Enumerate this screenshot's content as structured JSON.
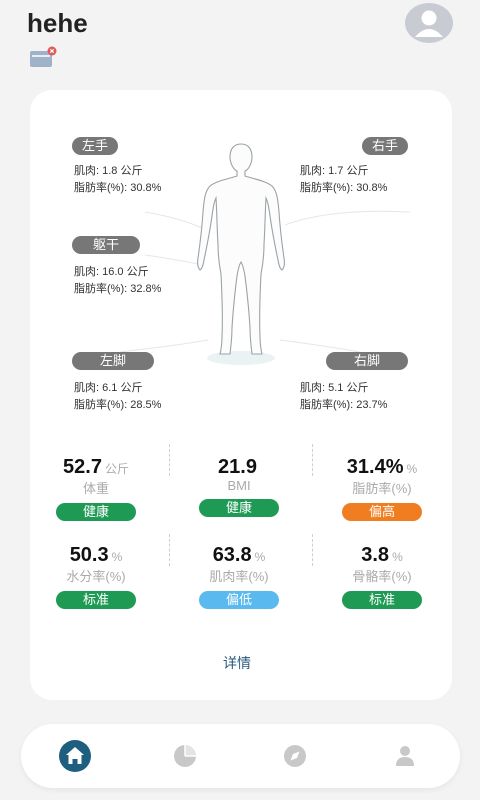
{
  "header": {
    "title": "hehe"
  },
  "segments": {
    "left_hand": {
      "name": "左手",
      "muscle": "肌肉: 1.8 公斤",
      "fat": "脂肪率(%): 30.8%"
    },
    "right_hand": {
      "name": "右手",
      "muscle": "肌肉: 1.7 公斤",
      "fat": "脂肪率(%): 30.8%"
    },
    "trunk": {
      "name": "躯干",
      "muscle": "肌肉: 16.0 公斤",
      "fat": "脂肪率(%): 32.8%"
    },
    "left_foot": {
      "name": "左脚",
      "muscle": "肌肉: 6.1 公斤",
      "fat": "脂肪率(%): 28.5%"
    },
    "right_foot": {
      "name": "右脚",
      "muscle": "肌肉: 5.1 公斤",
      "fat": "脂肪率(%): 23.7%"
    }
  },
  "metrics": [
    {
      "value": "52.7",
      "unit": "公斤",
      "label": "体重",
      "status": "健康",
      "color": "#1e9a55"
    },
    {
      "value": "21.9",
      "unit": "",
      "label": "BMI",
      "status": "健康",
      "color": "#1e9a55"
    },
    {
      "value": "31.4%",
      "unit": "%",
      "label": "脂肪率(%)",
      "status": "偏高",
      "color": "#f07d1f"
    },
    {
      "value": "50.3",
      "unit": "%",
      "label": "水分率(%)",
      "status": "标准",
      "color": "#1e9a55"
    },
    {
      "value": "63.8",
      "unit": "%",
      "label": "肌肉率(%)",
      "status": "偏低",
      "color": "#5ab9ee"
    },
    {
      "value": "3.8",
      "unit": "%",
      "label": "骨骼率(%)",
      "status": "标准",
      "color": "#1e9a55"
    }
  ],
  "detail_label": "详情",
  "tabbar": {
    "home_color": "#1e5e7e",
    "inactive_color": "#c8c8c8",
    "icons": [
      "home-icon",
      "pie-chart-icon",
      "compass-icon",
      "user-icon"
    ]
  }
}
